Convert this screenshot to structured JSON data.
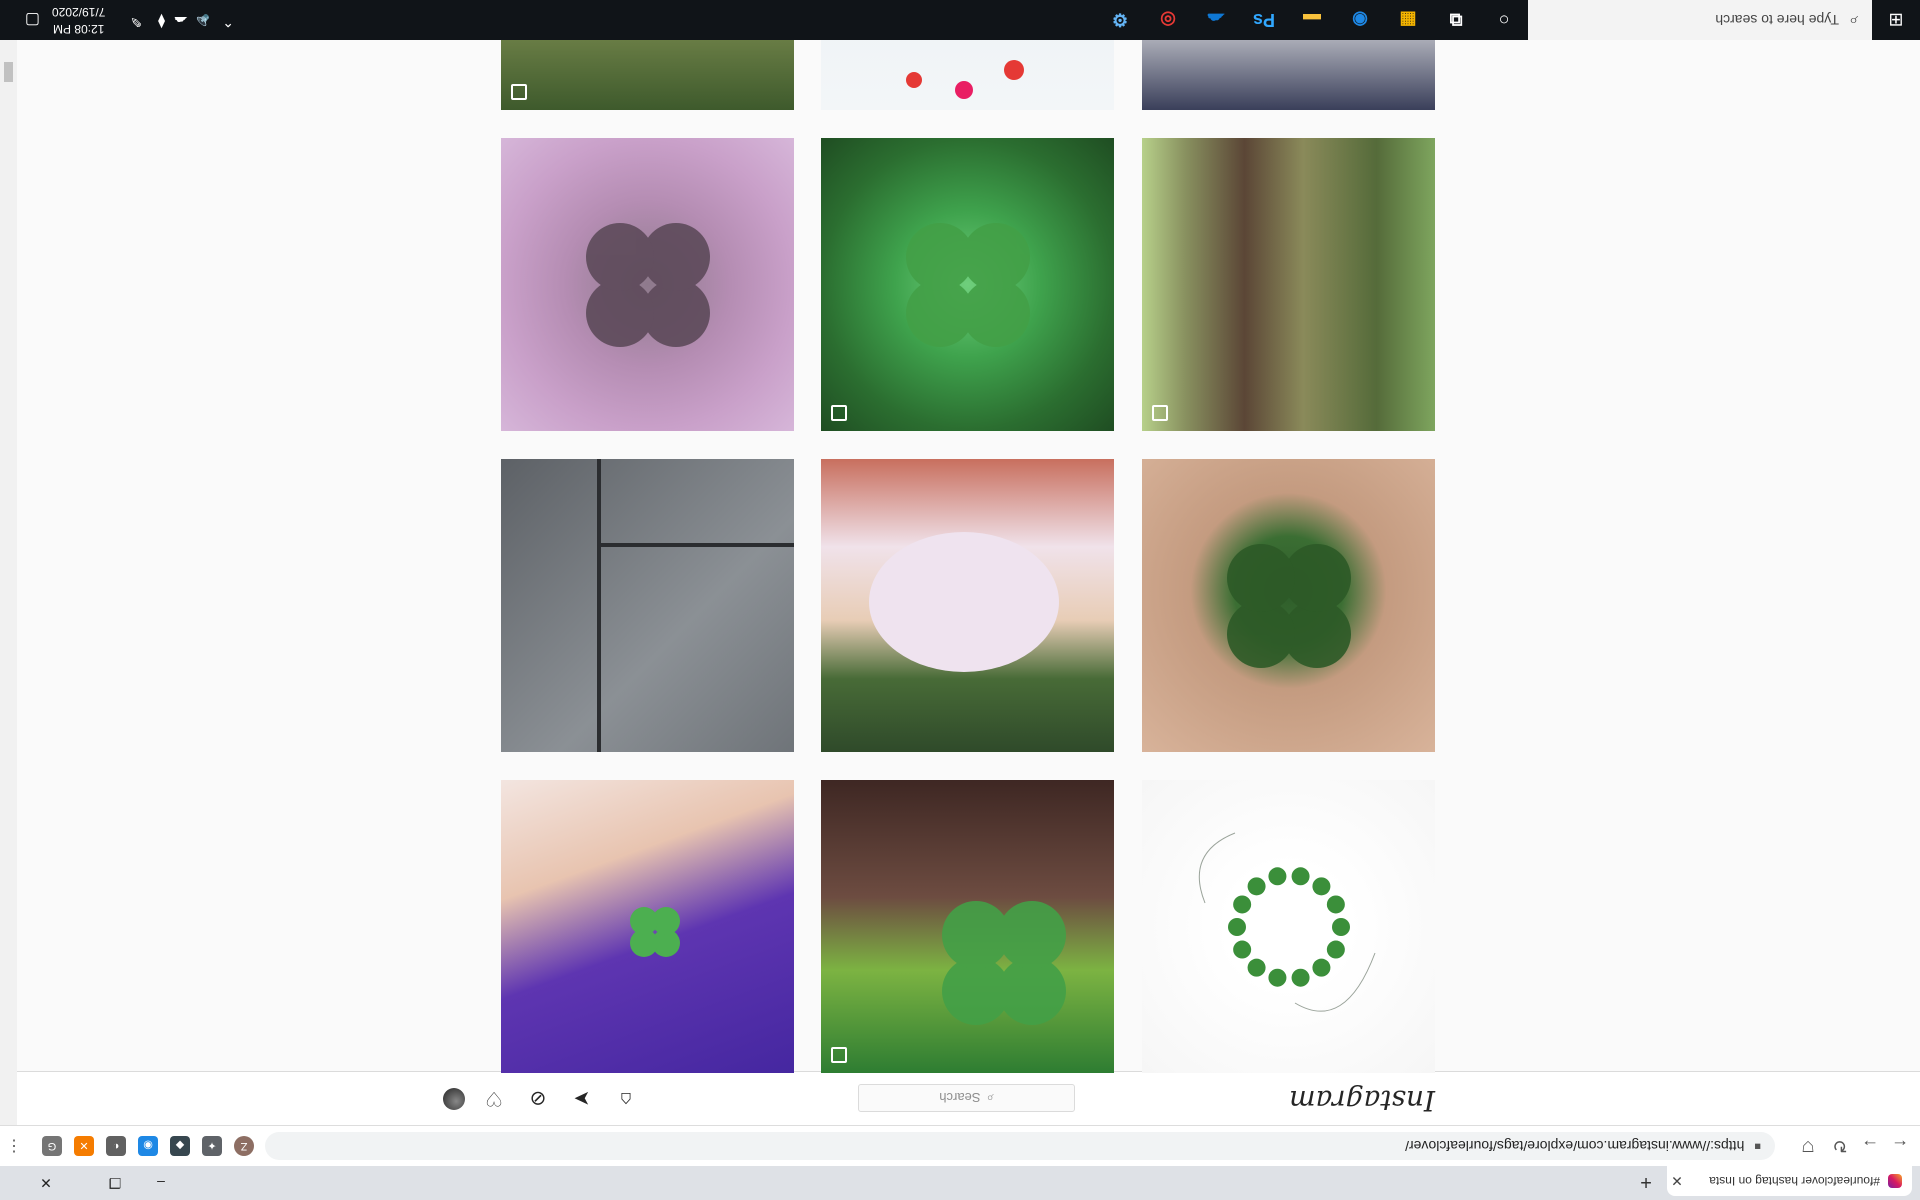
{
  "browser": {
    "tab_title": "#fourleafclover hashtag on Insta",
    "new_tab": "+",
    "url": "https://www.instagram.com/explore/tags/fourleafclover/",
    "controls": {
      "minimize": "–",
      "restore": "❐",
      "close": "✕"
    },
    "extensions": [
      {
        "name": "ext-z",
        "label": "Z",
        "color": "#8d6e63"
      },
      {
        "name": "ext-puzzle",
        "label": "✦",
        "color": "#5f6368"
      },
      {
        "name": "ext-bookmark",
        "label": "◆",
        "color": "#37474f"
      },
      {
        "name": "ext-blue",
        "label": "◉",
        "color": "#1e88e5"
      },
      {
        "name": "ext-grey",
        "label": "◐",
        "color": "#616161"
      },
      {
        "name": "ext-orange",
        "label": "✕",
        "color": "#f57c00"
      },
      {
        "name": "ext-g",
        "label": "G",
        "color": "#757575"
      }
    ]
  },
  "instagram": {
    "logo": "Instagram",
    "search_placeholder": "Search",
    "search_icon": "⌕"
  },
  "grid": [
    {
      "name": "post-clover-wreath",
      "bg": "radial-gradient(circle at 50% 50%,#ffffff 0%,#ffffff 30%,#f6f6f6 100%)",
      "detail": "wreath"
    },
    {
      "name": "post-dog-clover",
      "bg": "linear-gradient(180deg,#2e7d32 0%,#7cb342 35%,#6d4c41 60%,#3e2723 100%)",
      "detail": "dog",
      "multi": true
    },
    {
      "name": "post-purple-dress-clover",
      "bg": "linear-gradient(160deg,#4527a0 0%,#5e35b1 45%,#e8c4b0 70%,#f3e5e0 100%)",
      "detail": "dress"
    },
    {
      "name": "post-hand-clover",
      "bg": "radial-gradient(circle at 50% 55%,#2e5d2a 0%,#3b6e33 25%,#c49b80 45%,#d8b39a 100%)",
      "detail": "hand"
    },
    {
      "name": "post-mask-face",
      "bg": "linear-gradient(180deg,#2f4a2a 0%,#486b37 25%,#e8cdb6 45%,#f0e2ea 70%,#c86f5e 100%)",
      "detail": "mask"
    },
    {
      "name": "post-marble-floor",
      "bg": "linear-gradient(135deg,#6f7479 0%,#8b9095 40%,#5d6166 100%)",
      "detail": "marble"
    },
    {
      "name": "post-tree-bark",
      "bg": "linear-gradient(90deg,#7ea55e 0%,#556b3a 20%,#8a8a5a 45%,#5b4636 65%,#88905f 85%,#b7d08a 100%)",
      "detail": "bark",
      "multi": true
    },
    {
      "name": "post-green-clover",
      "bg": "radial-gradient(circle at 50% 50%,#6fcf7c 0%,#3fa34d 35%,#2b6e30 70%,#1f4d22 100%)",
      "detail": "clover",
      "multi": true
    },
    {
      "name": "post-pink-clover",
      "bg": "radial-gradient(circle at 50% 50%,#8e7a8c 0%,#b58db3 40%,#c9a0c9 70%,#d6b6d9 100%)",
      "detail": "pinkclover"
    },
    {
      "name": "post-top-right-partial",
      "bg": "linear-gradient(0deg,#ffffff 0%,#f5f5f5 60%,#3a3f5a 100%)",
      "detail": "none"
    },
    {
      "name": "post-top-middle-partial",
      "bg": "linear-gradient(0deg,#e7eef2 0%,#f3f6f8 100%)",
      "detail": "flowers"
    },
    {
      "name": "post-top-left-partial",
      "bg": "linear-gradient(0deg,#e6efe2 0%,#a8b06a 40%,#3e5a2c 100%)",
      "detail": "plate",
      "multi": true
    }
  ],
  "taskbar": {
    "search_placeholder": "Type here to search",
    "time": "12:08 PM",
    "date": "7/19/2020",
    "apps": [
      {
        "name": "cortana-icon",
        "glyph": "○",
        "color": "#ffffff"
      },
      {
        "name": "task-view-icon",
        "glyph": "⧉",
        "color": "#ffffff"
      },
      {
        "name": "store-icon",
        "glyph": "▦",
        "color": "#f4b400"
      },
      {
        "name": "edge-icon",
        "glyph": "◉",
        "color": "#1e88e5"
      },
      {
        "name": "file-explorer-icon",
        "glyph": "▬",
        "color": "#f9c23c"
      },
      {
        "name": "photoshop-icon",
        "glyph": "Ps",
        "color": "#31a8ff"
      },
      {
        "name": "onedrive-icon",
        "glyph": "☁",
        "color": "#0f78d4"
      },
      {
        "name": "chrome-icon",
        "glyph": "◎",
        "color": "#e53935"
      },
      {
        "name": "settings-app-icon",
        "glyph": "⚙",
        "color": "#64b5f6"
      }
    ]
  }
}
